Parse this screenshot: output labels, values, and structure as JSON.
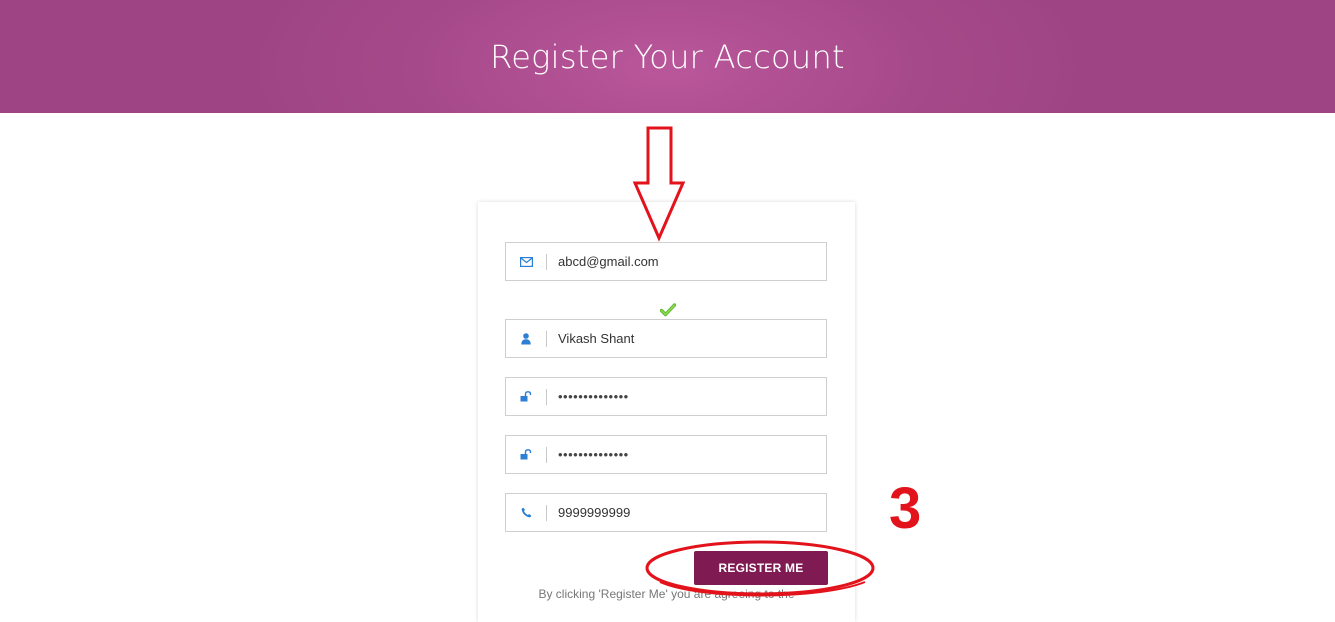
{
  "header": {
    "title": "Register Your Account"
  },
  "form": {
    "email": {
      "value": "abcd@gmail.com",
      "icon": "envelope-icon"
    },
    "name": {
      "value": "Vikash Shant",
      "icon": "user-icon"
    },
    "password": {
      "value": "••••••••••••••",
      "icon": "unlock-icon"
    },
    "confirm_password": {
      "value": "••••••••••••••",
      "icon": "unlock-icon"
    },
    "phone": {
      "value": "9999999999",
      "icon": "phone-icon"
    },
    "valid_icon": "checkmark-icon",
    "submit_label": "REGISTER ME",
    "terms_text": "By clicking 'Register Me' you are agreeing to the"
  },
  "annotations": {
    "step_number": "3",
    "color": "#e3131b"
  },
  "colors": {
    "header": "#a6498a",
    "button": "#7f1a52",
    "icon": "#2d7fd3"
  }
}
